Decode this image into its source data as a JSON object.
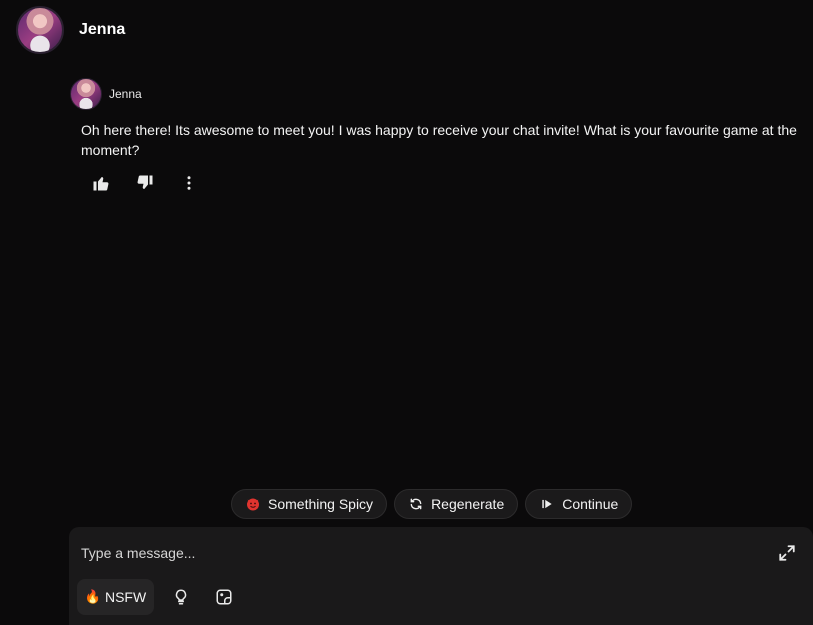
{
  "header": {
    "name": "Jenna"
  },
  "message": {
    "author": "Jenna",
    "text": "Oh here there! Its awesome to meet you! I was happy to receive your chat invite! What is your favourite game at the moment?"
  },
  "quick_actions": [
    {
      "label": "Something Spicy",
      "icon": "devil-face-icon"
    },
    {
      "label": "Regenerate",
      "icon": "refresh-icon"
    },
    {
      "label": "Continue",
      "icon": "play-next-icon"
    }
  ],
  "composer": {
    "placeholder": "Type a message...",
    "nsfw_label": "NSFW"
  }
}
